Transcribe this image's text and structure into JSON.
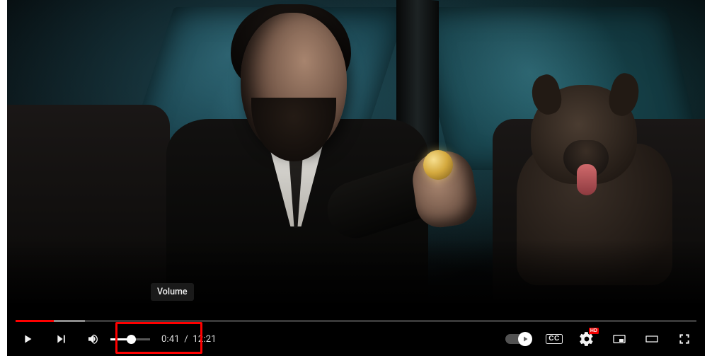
{
  "tooltip": {
    "volume": "Volume"
  },
  "progress": {
    "played_pct": 5.6,
    "loaded_pct": 10.2
  },
  "volume": {
    "level_pct": 52
  },
  "time": {
    "current": "0:41",
    "duration": "12:21",
    "separator": "/"
  },
  "controls": {
    "cc_label": "CC",
    "hd_badge": "HD"
  }
}
